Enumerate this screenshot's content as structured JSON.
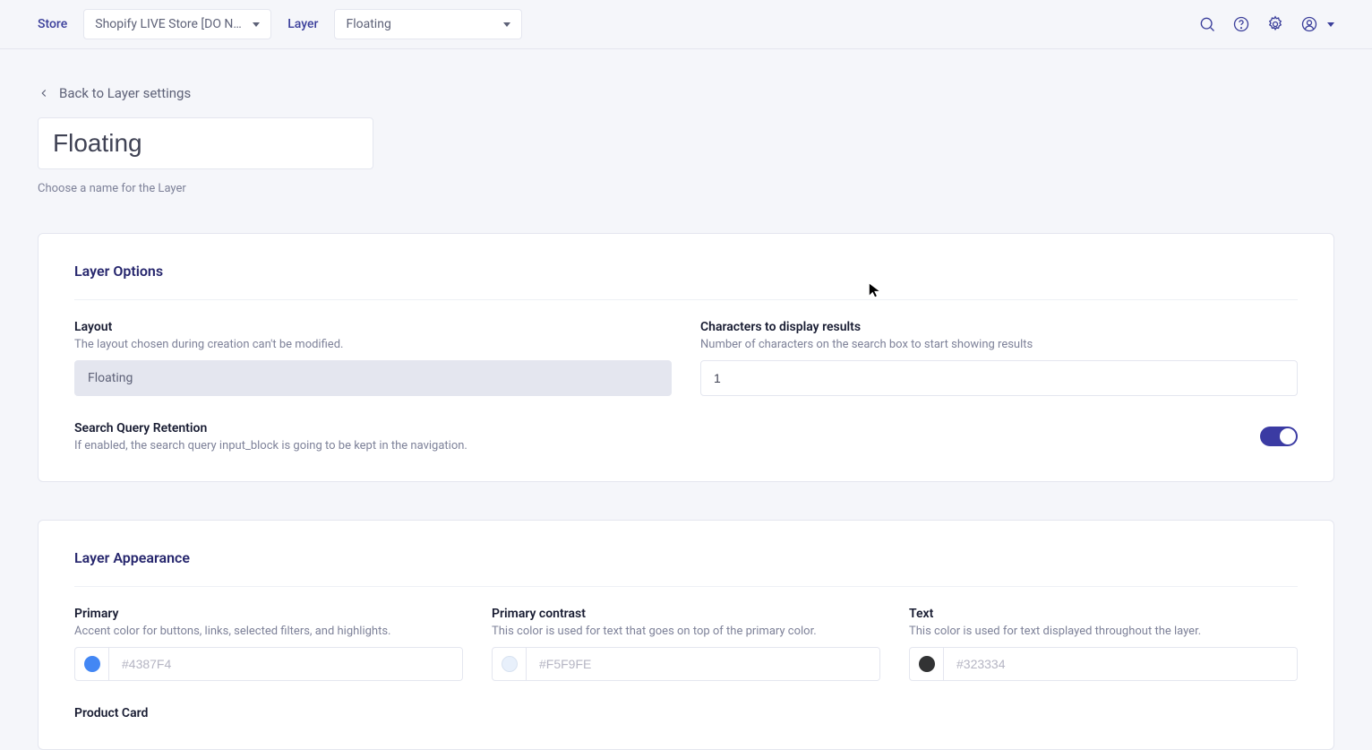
{
  "topbar": {
    "store_label": "Store",
    "store_value": "Shopify LIVE Store [DO N…",
    "layer_label": "Layer",
    "layer_value": "Floating"
  },
  "back_link": "Back to Layer settings",
  "layer_name": "Floating",
  "layer_name_helper": "Choose a name for the Layer",
  "options_card": {
    "title": "Layer Options",
    "layout": {
      "label": "Layout",
      "sub": "The layout chosen during creation can't be modified.",
      "value": "Floating"
    },
    "chars": {
      "label": "Characters to display results",
      "sub": "Number of characters on the search box to start showing results",
      "value": "1"
    },
    "retention": {
      "label": "Search Query Retention",
      "sub": "If enabled, the search query input_block is going to be kept in the navigation."
    }
  },
  "appearance_card": {
    "title": "Layer Appearance",
    "primary": {
      "label": "Primary",
      "sub": "Accent color for buttons, links, selected filters, and highlights.",
      "placeholder": "#4387F4",
      "swatch": "#4387F4"
    },
    "contrast": {
      "label": "Primary contrast",
      "sub": "This color is used for text that goes on top of the primary color.",
      "placeholder": "#F5F9FE",
      "swatch": "#e8f0fb"
    },
    "text": {
      "label": "Text",
      "sub": "This color is used for text displayed throughout the layer.",
      "placeholder": "#323334",
      "swatch": "#323334"
    },
    "product_card": "Product Card"
  }
}
